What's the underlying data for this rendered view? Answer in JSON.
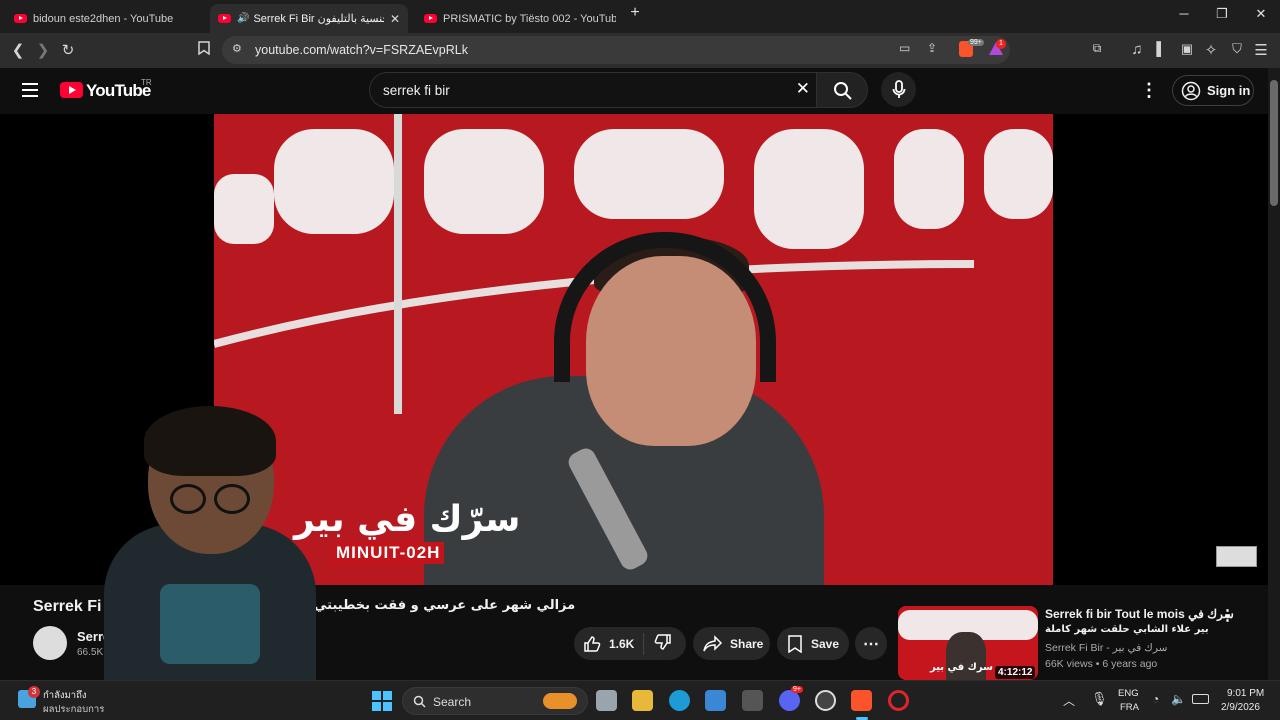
{
  "browser": {
    "tabs": [
      {
        "title": "bidoun este2dhen - YouTube",
        "active": false
      },
      {
        "title": "Serrek Fi Bir جنسية بالتليفون",
        "active": true,
        "audio": "speaker-icon"
      },
      {
        "title": "PRISMATIC by Tiësto 002 - YouTube",
        "active": false
      }
    ],
    "new_tab": "+",
    "window_controls": {
      "minimize": "─",
      "restore": "❐",
      "close": "✕"
    },
    "url": "youtube.com/watch?v=FSRZAEvpRLk",
    "brave_badge": "99+",
    "rewards_badge": "1"
  },
  "youtube": {
    "logo_text": "YouTube",
    "region": "TR",
    "search_value": "serrek fi bir",
    "sign_in": "Sign in"
  },
  "video": {
    "watermark": "سرّك في بير",
    "watermark_sub": "MINUIT-02H",
    "title_en": "Serrek Fi B",
    "title_ar": "مزالي شهر على عرسي و فقت بخطيبتي",
    "channel_name": "Serre",
    "subscribers": "66.5K su",
    "likes": "1.6K",
    "share_label": "Share",
    "save_label": "Save"
  },
  "recommendation": {
    "title_line1": "Serrek fi bir Tout le mois  سرك في",
    "title_line2": "بير علاء الشابي حلقت شهر كاملة",
    "channel": "Serrek Fi Bir - سرك في بير",
    "views": "66K views",
    "age": "6 years ago",
    "duration": "4:12:12",
    "thumb_text": "سرك في بير"
  },
  "taskbar": {
    "weather_badge": "3",
    "weather_line1": "กำลังมาถึง",
    "weather_line2": "ผลประกอบการ",
    "search_label": "Search",
    "discord_badge": "9+",
    "lang_line1": "ENG",
    "lang_line2": "FRA",
    "time": "9:01 PM",
    "date": "2/9/2026"
  },
  "colors": {
    "yt_red": "#ff0033",
    "bg": "#0f0f0f",
    "pill": "#272727",
    "video_red": "#b8181f"
  }
}
